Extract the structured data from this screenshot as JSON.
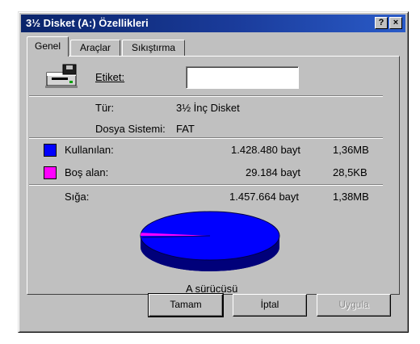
{
  "window": {
    "title": "3½ Disket (A:) Özellikleri"
  },
  "titlebar_buttons": {
    "help": "?",
    "close": "×"
  },
  "tabs": [
    {
      "label": "Genel",
      "active": true
    },
    {
      "label": "Araçlar",
      "active": false
    },
    {
      "label": "Sıkıştırma",
      "active": false
    }
  ],
  "general": {
    "label_caption": "Etiket:",
    "label_value": "",
    "type_caption": "Tür:",
    "type_value": "3½ İnç Disket",
    "fs_caption": "Dosya Sistemi:",
    "fs_value": "FAT",
    "used": {
      "caption": "Kullanılan:",
      "bytes": "1.428.480 bayt",
      "size": "1,36MB",
      "color": "#0000ff"
    },
    "free": {
      "caption": "Boş alan:",
      "bytes": "29.184 bayt",
      "size": "28,5KB",
      "color": "#ff00ff"
    },
    "capacity": {
      "caption": "Sığa:",
      "bytes": "1.457.664 bayt",
      "size": "1,38MB"
    },
    "drive_caption": "A sürücüsü",
    "pie_used_fraction": 0.98
  },
  "icons": {
    "drive": "floppy-drive-icon"
  },
  "buttons": {
    "ok": "Tamam",
    "cancel": "İptal",
    "apply": "Uygula"
  }
}
